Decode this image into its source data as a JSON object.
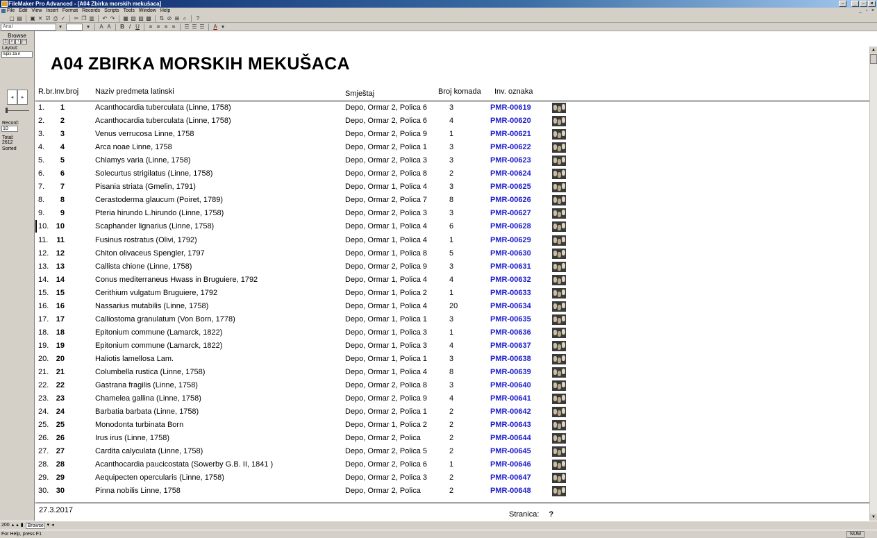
{
  "window": {
    "title": "FileMaker Pro Advanced - [A04 Zbirka morskih mekušaca]"
  },
  "menu": [
    "File",
    "Edit",
    "View",
    "Insert",
    "Format",
    "Records",
    "Scripts",
    "Tools",
    "Window",
    "Help"
  ],
  "format_toolbar": {
    "font": "Arial"
  },
  "status_area": {
    "mode": "Browse",
    "layout_label": "Layout:",
    "layout_value": "Ispis za n",
    "record_label": "Record:",
    "record_value": "10",
    "total_label": "Total:",
    "total_value": "2612",
    "sorted_label": "Sorted"
  },
  "report": {
    "title": "A04 ZBIRKA MORSKIH MEKUŠACA",
    "headers": {
      "rbr": "R.br.",
      "inv": "Inv.broj",
      "naziv": "Naziv predmeta latinski",
      "smjestaj": "Smještaj",
      "broj": "Broj komada",
      "oznaka": "Inv. oznaka"
    },
    "rows": [
      {
        "rbr": "1.",
        "inv": "1",
        "naziv": "Acanthocardia tuberculata (Linne, 1758)",
        "smjestaj": "Depo, Ormar 2, Polica 6",
        "broj": "3",
        "oznaka": "PMR-00619"
      },
      {
        "rbr": "2.",
        "inv": "2",
        "naziv": "Acanthocardia tuberculata (Linne, 1758)",
        "smjestaj": "Depo, Ormar 2, Polica 6",
        "broj": "4",
        "oznaka": "PMR-00620"
      },
      {
        "rbr": "3.",
        "inv": "3",
        "naziv": "Venus verrucosa Linne, 1758",
        "smjestaj": "Depo, Ormar 2, Polica 9",
        "broj": "1",
        "oznaka": "PMR-00621"
      },
      {
        "rbr": "4.",
        "inv": "4",
        "naziv": "Arca noae Linne, 1758",
        "smjestaj": "Depo, Ormar 2, Polica 1",
        "broj": "3",
        "oznaka": "PMR-00622"
      },
      {
        "rbr": "5.",
        "inv": "5",
        "naziv": "Chlamys varia (Linne, 1758)",
        "smjestaj": "Depo, Ormar 2, Polica 3",
        "broj": "3",
        "oznaka": "PMR-00623"
      },
      {
        "rbr": "6.",
        "inv": "6",
        "naziv": "Solecurtus strigilatus (Linne, 1758)",
        "smjestaj": "Depo, Ormar 2, Polica 8",
        "broj": "2",
        "oznaka": "PMR-00624"
      },
      {
        "rbr": "7.",
        "inv": "7",
        "naziv": "Pisania striata (Gmelin, 1791)",
        "smjestaj": "Depo, Ormar 1, Polica 4",
        "broj": "3",
        "oznaka": "PMR-00625"
      },
      {
        "rbr": "8.",
        "inv": "8",
        "naziv": "Cerastoderma glaucum (Poiret, 1789)",
        "smjestaj": "Depo, Ormar 2, Polica 7",
        "broj": "8",
        "oznaka": "PMR-00626"
      },
      {
        "rbr": "9.",
        "inv": "9",
        "naziv": "Pteria hirundo L.hirundo (Linne, 1758)",
        "smjestaj": "Depo, Ormar 2, Polica 3",
        "broj": "3",
        "oznaka": "PMR-00627"
      },
      {
        "rbr": "10.",
        "inv": "10",
        "naziv": "Scaphander lignarius (Linne, 1758)",
        "smjestaj": "Depo, Ormar 1, Polica 4",
        "broj": "6",
        "oznaka": "PMR-00628"
      },
      {
        "rbr": "11.",
        "inv": "11",
        "naziv": "Fusinus rostratus (Olivi, 1792)",
        "smjestaj": "Depo, Ormar 1, Polica 4",
        "broj": "1",
        "oznaka": "PMR-00629"
      },
      {
        "rbr": "12.",
        "inv": "12",
        "naziv": "Chiton olivaceus Spengler, 1797",
        "smjestaj": "Depo, Ormar 1, Polica 8",
        "broj": "5",
        "oznaka": "PMR-00630"
      },
      {
        "rbr": "13.",
        "inv": "13",
        "naziv": "Callista chione (Linne, 1758)",
        "smjestaj": "Depo, Ormar 2, Polica 9",
        "broj": "3",
        "oznaka": "PMR-00631"
      },
      {
        "rbr": "14.",
        "inv": "14",
        "naziv": "Conus mediterraneus Hwass in Bruguiere, 1792",
        "smjestaj": "Depo, Ormar 1, Polica 4",
        "broj": "4",
        "oznaka": "PMR-00632"
      },
      {
        "rbr": "15.",
        "inv": "15",
        "naziv": "Cerithium vulgatum Bruguiere, 1792",
        "smjestaj": "Depo, Ormar 1, Polica 2",
        "broj": "1",
        "oznaka": "PMR-00633"
      },
      {
        "rbr": "16.",
        "inv": "16",
        "naziv": "Nassarius mutabilis (Linne, 1758)",
        "smjestaj": "Depo, Ormar 1, Polica 4",
        "broj": "20",
        "oznaka": "PMR-00634"
      },
      {
        "rbr": "17.",
        "inv": "17",
        "naziv": "Calliostoma granulatum (Von Born, 1778)",
        "smjestaj": "Depo, Ormar 1, Polica 1",
        "broj": "3",
        "oznaka": "PMR-00635"
      },
      {
        "rbr": "18.",
        "inv": "18",
        "naziv": "Epitonium commune (Lamarck, 1822)",
        "smjestaj": "Depo, Ormar 1, Polica 3",
        "broj": "1",
        "oznaka": "PMR-00636"
      },
      {
        "rbr": "19.",
        "inv": "19",
        "naziv": "Epitonium commune (Lamarck, 1822)",
        "smjestaj": "Depo, Ormar 1, Polica 3",
        "broj": "4",
        "oznaka": "PMR-00637"
      },
      {
        "rbr": "20.",
        "inv": "20",
        "naziv": "Haliotis lamellosa Lam.",
        "smjestaj": "Depo, Ormar 1, Polica 1",
        "broj": "3",
        "oznaka": "PMR-00638"
      },
      {
        "rbr": "21.",
        "inv": "21",
        "naziv": "Columbella rustica (Linne, 1758)",
        "smjestaj": "Depo, Ormar 1, Polica 4",
        "broj": "8",
        "oznaka": "PMR-00639"
      },
      {
        "rbr": "22.",
        "inv": "22",
        "naziv": "Gastrana fragilis (Linne, 1758)",
        "smjestaj": "Depo, Ormar 2, Polica 8",
        "broj": "3",
        "oznaka": "PMR-00640"
      },
      {
        "rbr": "23.",
        "inv": "23",
        "naziv": "Chamelea gallina (Linne, 1758)",
        "smjestaj": "Depo, Ormar 2, Polica 9",
        "broj": "4",
        "oznaka": "PMR-00641"
      },
      {
        "rbr": "24.",
        "inv": "24",
        "naziv": "Barbatia barbata (Linne, 1758)",
        "smjestaj": "Depo, Ormar 2, Polica 1",
        "broj": "2",
        "oznaka": "PMR-00642"
      },
      {
        "rbr": "25.",
        "inv": "25",
        "naziv": "Monodonta turbinata Born",
        "smjestaj": "Depo, Ormar 1, Polica 2",
        "broj": "2",
        "oznaka": "PMR-00643"
      },
      {
        "rbr": "26.",
        "inv": "26",
        "naziv": "Irus irus (Linne, 1758)",
        "smjestaj": "Depo, Ormar 2, Polica",
        "broj": "2",
        "oznaka": "PMR-00644"
      },
      {
        "rbr": "27.",
        "inv": "27",
        "naziv": "Cardita calyculata (Linne, 1758)",
        "smjestaj": "Depo, Ormar 2, Polica 5",
        "broj": "2",
        "oznaka": "PMR-00645"
      },
      {
        "rbr": "28.",
        "inv": "28",
        "naziv": "Acanthocardia paucicostata (Sowerby G.B. II, 1841 )",
        "smjestaj": "Depo, Ormar 2, Polica 6",
        "broj": "1",
        "oznaka": "PMR-00646"
      },
      {
        "rbr": "29.",
        "inv": "29",
        "naziv": "Aequipecten opercularis (Linne, 1758)",
        "smjestaj": "Depo, Ormar 2, Polica 3",
        "broj": "2",
        "oznaka": "PMR-00647"
      },
      {
        "rbr": "30.",
        "inv": "30",
        "naziv": "Pinna nobilis Linne, 1758",
        "smjestaj": "Depo, Ormar 2, Polica",
        "broj": "2",
        "oznaka": "PMR-00648"
      }
    ],
    "footer": {
      "date": "27.3.2017",
      "page_label": "Stranica:",
      "page_value": "?"
    }
  },
  "bottom_bar": {
    "zoom": "200",
    "mode": "Browse"
  },
  "status_bar": {
    "help": "For Help, press F1",
    "num": "NUM"
  },
  "colors": {
    "link": "#1a1acc",
    "chrome": "#d4d0c8",
    "titlebar": "#0a246a"
  }
}
